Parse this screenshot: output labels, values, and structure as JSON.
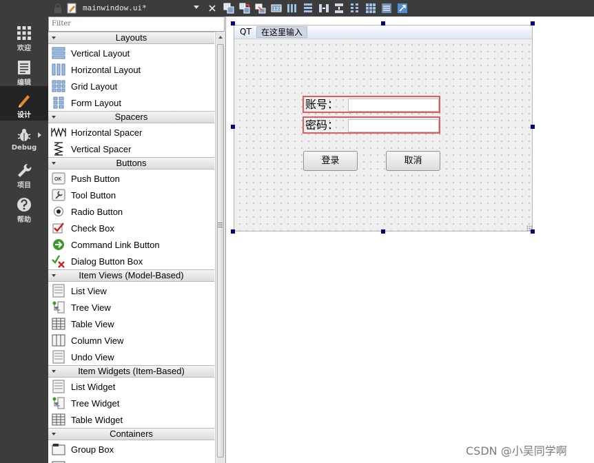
{
  "modes": [
    {
      "label": "欢迎",
      "icon": "welcome-grid-icon",
      "active": false
    },
    {
      "label": "编辑",
      "icon": "edit-document-icon",
      "active": false
    },
    {
      "label": "设计",
      "icon": "design-pencil-icon",
      "active": true
    },
    {
      "label": "Debug",
      "icon": "debug-bug-icon",
      "active": false
    },
    {
      "label": "项目",
      "icon": "project-wrench-icon",
      "active": false
    },
    {
      "label": "帮助",
      "icon": "help-question-icon",
      "active": false
    }
  ],
  "editor": {
    "document_name": "mainwindow.ui*"
  },
  "widget_box": {
    "filter_placeholder": "Filter",
    "categories": {
      "layouts": "Layouts",
      "spacers": "Spacers",
      "buttons": "Buttons",
      "item_views": "Item Views (Model-Based)",
      "item_widgets": "Item Widgets (Item-Based)",
      "containers": "Containers"
    },
    "items": {
      "vertical_layout": "Vertical Layout",
      "horizontal_layout": "Horizontal Layout",
      "grid_layout": "Grid Layout",
      "form_layout": "Form Layout",
      "horizontal_spacer": "Horizontal Spacer",
      "vertical_spacer": "Vertical Spacer",
      "push_button": "Push Button",
      "tool_button": "Tool Button",
      "radio_button": "Radio Button",
      "check_box": "Check Box",
      "command_link_button": "Command Link Button",
      "dialog_button_box": "Dialog Button Box",
      "list_view": "List View",
      "tree_view": "Tree View",
      "table_view": "Table View",
      "column_view": "Column View",
      "undo_view": "Undo View",
      "list_widget": "List Widget",
      "tree_widget": "Tree Widget",
      "table_widget": "Table Widget",
      "group_box": "Group Box"
    },
    "push_button_icon_text": "OK"
  },
  "form": {
    "menu": {
      "qt": "QT",
      "type_here": "在这里输入"
    },
    "account_label": "账号：",
    "password_label": "密码：",
    "login_button": "登录",
    "cancel_button": "取消"
  },
  "watermark": "CSDN @小吴同学啊",
  "colors": {
    "mode_bar_bg": "#3c3c3c",
    "mode_active_bg": "#242424",
    "design_accent": "#e8862b",
    "selection_handle": "#000080",
    "layout_outline": "#e45b5b"
  }
}
